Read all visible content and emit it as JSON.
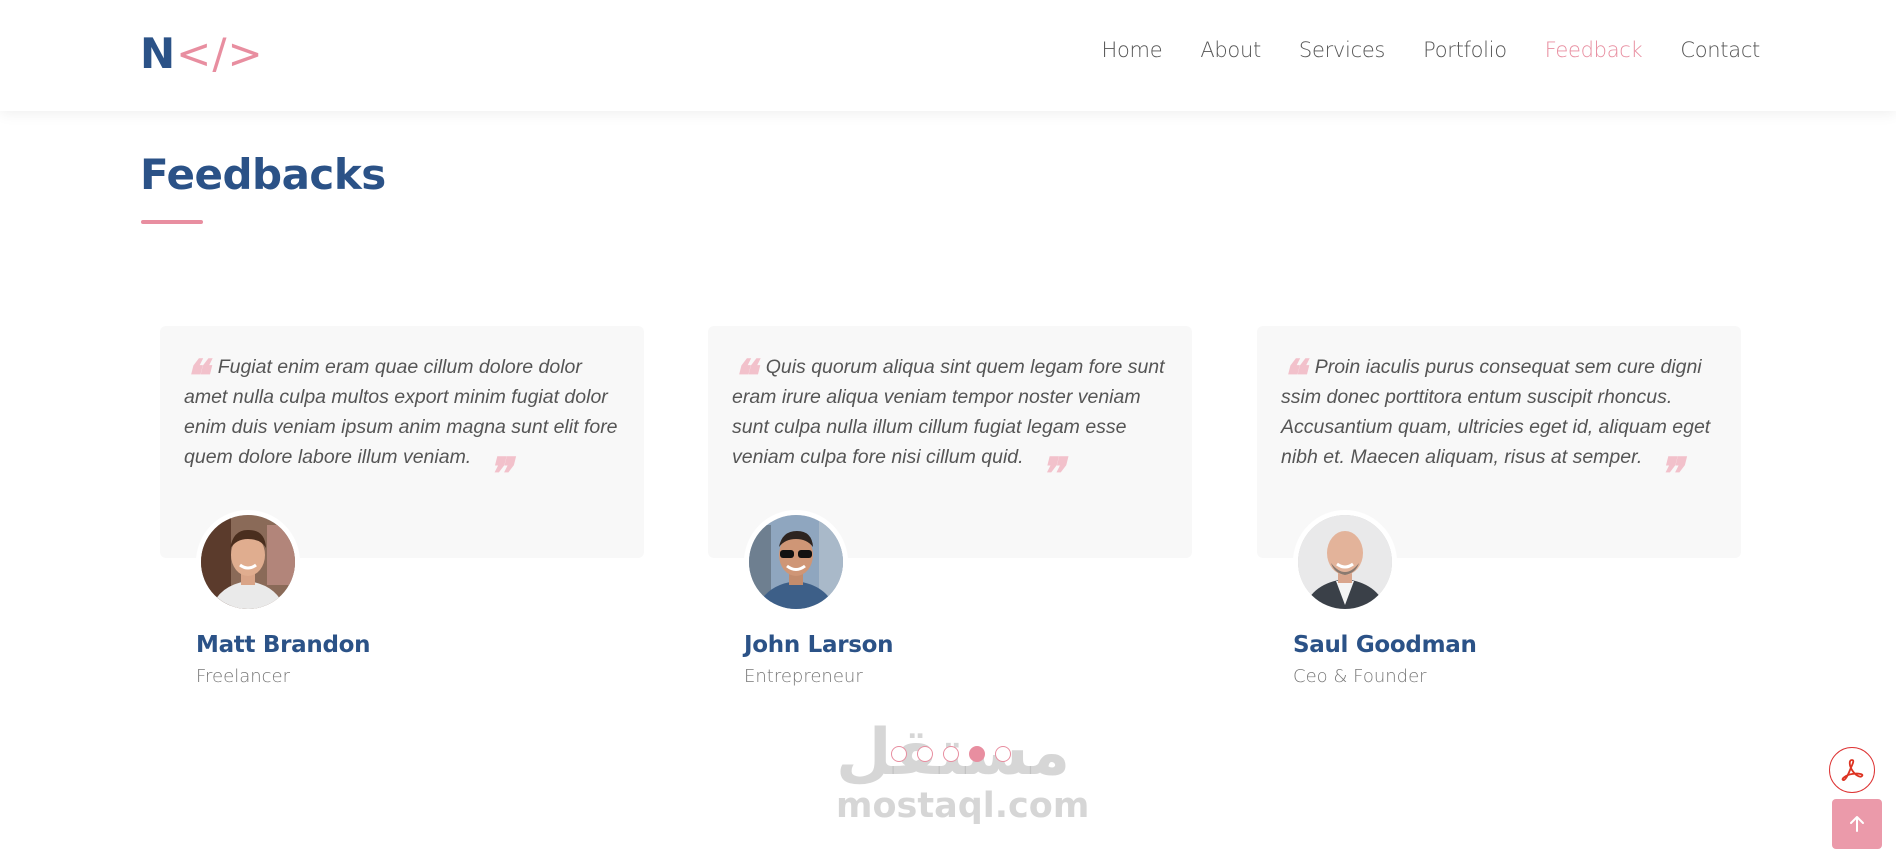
{
  "header": {
    "logo_letter": "N",
    "logo_tag": "</>",
    "nav": [
      {
        "label": "Home",
        "active": false
      },
      {
        "label": "About",
        "active": false
      },
      {
        "label": "Services",
        "active": false
      },
      {
        "label": "Portfolio",
        "active": false
      },
      {
        "label": "Feedback",
        "active": true
      },
      {
        "label": "Contact",
        "active": false
      }
    ]
  },
  "section": {
    "title": "Feedbacks"
  },
  "testimonials": [
    {
      "quote": "Fugiat enim eram quae cillum dolore dolor amet nulla culpa multos export minim fugiat dolor enim duis veniam ipsum anim magna sunt elit fore quem dolore labore illum veniam.",
      "name": "Matt Brandon",
      "role": "Freelancer"
    },
    {
      "quote": "Quis quorum aliqua sint quem legam fore sunt eram irure aliqua veniam tempor noster veniam sunt culpa nulla illum cillum fugiat legam esse veniam culpa fore nisi cillum quid.",
      "name": "John Larson",
      "role": "Entrepreneur"
    },
    {
      "quote": "Proin iaculis purus consequat sem cure digni ssim donec porttitora entum suscipit rhoncus. Accusantium quam, ultricies eget id, aliquam eget nibh et. Maecen aliquam, risus at semper.",
      "name": "Saul Goodman",
      "role": "Ceo & Founder"
    }
  ],
  "carousel": {
    "dot_count": 5,
    "active_index": 3
  },
  "watermark": {
    "arabic": "مستقل",
    "latin": "mostaql.com"
  },
  "colors": {
    "primary": "#2b5287",
    "accent": "#e88ea0",
    "card_bg": "#f8f8f8"
  }
}
